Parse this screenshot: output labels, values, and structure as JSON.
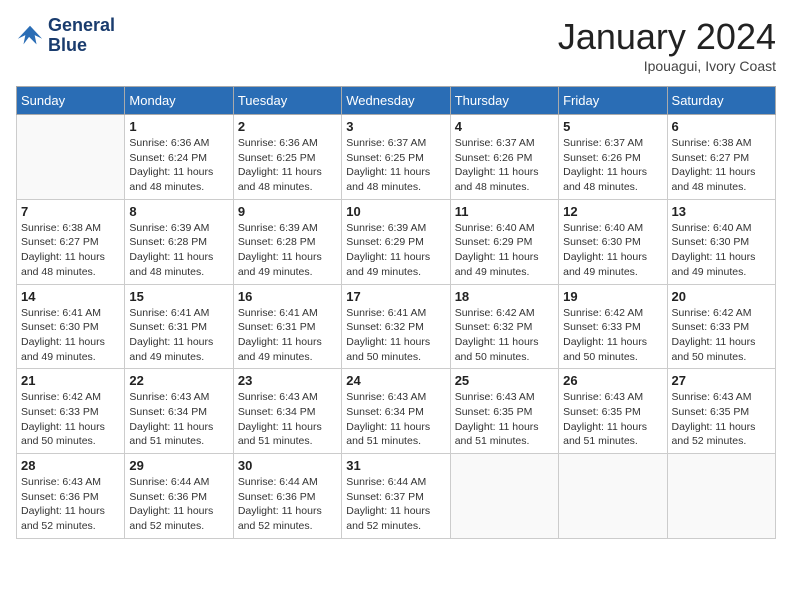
{
  "logo": {
    "line1": "General",
    "line2": "Blue"
  },
  "title": "January 2024",
  "subtitle": "Ipouagui, Ivory Coast",
  "days_of_week": [
    "Sunday",
    "Monday",
    "Tuesday",
    "Wednesday",
    "Thursday",
    "Friday",
    "Saturday"
  ],
  "weeks": [
    [
      {
        "day": "",
        "info": ""
      },
      {
        "day": "1",
        "info": "Sunrise: 6:36 AM\nSunset: 6:24 PM\nDaylight: 11 hours and 48 minutes."
      },
      {
        "day": "2",
        "info": "Sunrise: 6:36 AM\nSunset: 6:25 PM\nDaylight: 11 hours and 48 minutes."
      },
      {
        "day": "3",
        "info": "Sunrise: 6:37 AM\nSunset: 6:25 PM\nDaylight: 11 hours and 48 minutes."
      },
      {
        "day": "4",
        "info": "Sunrise: 6:37 AM\nSunset: 6:26 PM\nDaylight: 11 hours and 48 minutes."
      },
      {
        "day": "5",
        "info": "Sunrise: 6:37 AM\nSunset: 6:26 PM\nDaylight: 11 hours and 48 minutes."
      },
      {
        "day": "6",
        "info": "Sunrise: 6:38 AM\nSunset: 6:27 PM\nDaylight: 11 hours and 48 minutes."
      }
    ],
    [
      {
        "day": "7",
        "info": "Sunrise: 6:38 AM\nSunset: 6:27 PM\nDaylight: 11 hours and 48 minutes."
      },
      {
        "day": "8",
        "info": "Sunrise: 6:39 AM\nSunset: 6:28 PM\nDaylight: 11 hours and 48 minutes."
      },
      {
        "day": "9",
        "info": "Sunrise: 6:39 AM\nSunset: 6:28 PM\nDaylight: 11 hours and 49 minutes."
      },
      {
        "day": "10",
        "info": "Sunrise: 6:39 AM\nSunset: 6:29 PM\nDaylight: 11 hours and 49 minutes."
      },
      {
        "day": "11",
        "info": "Sunrise: 6:40 AM\nSunset: 6:29 PM\nDaylight: 11 hours and 49 minutes."
      },
      {
        "day": "12",
        "info": "Sunrise: 6:40 AM\nSunset: 6:30 PM\nDaylight: 11 hours and 49 minutes."
      },
      {
        "day": "13",
        "info": "Sunrise: 6:40 AM\nSunset: 6:30 PM\nDaylight: 11 hours and 49 minutes."
      }
    ],
    [
      {
        "day": "14",
        "info": "Sunrise: 6:41 AM\nSunset: 6:30 PM\nDaylight: 11 hours and 49 minutes."
      },
      {
        "day": "15",
        "info": "Sunrise: 6:41 AM\nSunset: 6:31 PM\nDaylight: 11 hours and 49 minutes."
      },
      {
        "day": "16",
        "info": "Sunrise: 6:41 AM\nSunset: 6:31 PM\nDaylight: 11 hours and 49 minutes."
      },
      {
        "day": "17",
        "info": "Sunrise: 6:41 AM\nSunset: 6:32 PM\nDaylight: 11 hours and 50 minutes."
      },
      {
        "day": "18",
        "info": "Sunrise: 6:42 AM\nSunset: 6:32 PM\nDaylight: 11 hours and 50 minutes."
      },
      {
        "day": "19",
        "info": "Sunrise: 6:42 AM\nSunset: 6:33 PM\nDaylight: 11 hours and 50 minutes."
      },
      {
        "day": "20",
        "info": "Sunrise: 6:42 AM\nSunset: 6:33 PM\nDaylight: 11 hours and 50 minutes."
      }
    ],
    [
      {
        "day": "21",
        "info": "Sunrise: 6:42 AM\nSunset: 6:33 PM\nDaylight: 11 hours and 50 minutes."
      },
      {
        "day": "22",
        "info": "Sunrise: 6:43 AM\nSunset: 6:34 PM\nDaylight: 11 hours and 51 minutes."
      },
      {
        "day": "23",
        "info": "Sunrise: 6:43 AM\nSunset: 6:34 PM\nDaylight: 11 hours and 51 minutes."
      },
      {
        "day": "24",
        "info": "Sunrise: 6:43 AM\nSunset: 6:34 PM\nDaylight: 11 hours and 51 minutes."
      },
      {
        "day": "25",
        "info": "Sunrise: 6:43 AM\nSunset: 6:35 PM\nDaylight: 11 hours and 51 minutes."
      },
      {
        "day": "26",
        "info": "Sunrise: 6:43 AM\nSunset: 6:35 PM\nDaylight: 11 hours and 51 minutes."
      },
      {
        "day": "27",
        "info": "Sunrise: 6:43 AM\nSunset: 6:35 PM\nDaylight: 11 hours and 52 minutes."
      }
    ],
    [
      {
        "day": "28",
        "info": "Sunrise: 6:43 AM\nSunset: 6:36 PM\nDaylight: 11 hours and 52 minutes."
      },
      {
        "day": "29",
        "info": "Sunrise: 6:44 AM\nSunset: 6:36 PM\nDaylight: 11 hours and 52 minutes."
      },
      {
        "day": "30",
        "info": "Sunrise: 6:44 AM\nSunset: 6:36 PM\nDaylight: 11 hours and 52 minutes."
      },
      {
        "day": "31",
        "info": "Sunrise: 6:44 AM\nSunset: 6:37 PM\nDaylight: 11 hours and 52 minutes."
      },
      {
        "day": "",
        "info": ""
      },
      {
        "day": "",
        "info": ""
      },
      {
        "day": "",
        "info": ""
      }
    ]
  ]
}
